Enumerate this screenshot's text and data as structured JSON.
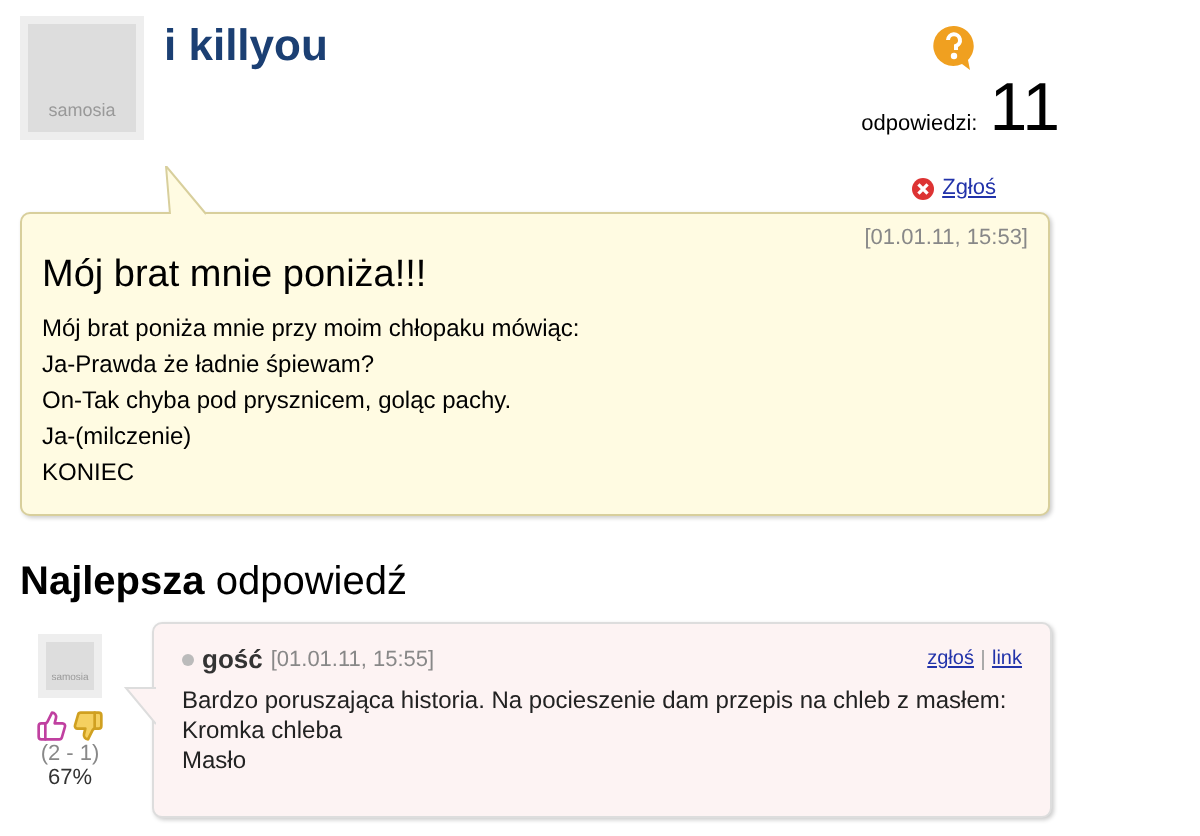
{
  "question": {
    "author": "i killyou",
    "avatar_label": "samosia",
    "answers_label": "odpowiedzi:",
    "answers_count": "11",
    "report": "Zgłoś",
    "date": "[01.01.11, 15:53]",
    "title": "Mój brat mnie poniża!!!",
    "body": [
      "Mój brat poniża mnie przy moim chłopaku mówiąc:",
      "Ja-Prawda że ładnie śpiewam?",
      "On-Tak chyba pod prysznicem, goląc pachy.",
      "Ja-(milczenie)",
      "KONIEC"
    ]
  },
  "best_answer": {
    "heading": "**Najlepsza** odpowiedź",
    "avatar_label": "samosia",
    "votes": "(2 - 1)",
    "percent": "67%",
    "author": "gość",
    "date": "[01.01.11, 15:55]",
    "links": [
      "zgłoś",
      "link"
    ],
    "body": [
      "Bardzo poruszająca historia. Na pocieszenie dam przepis na chleb z masłem:",
      "Kromka chleba",
      "Masło"
    ]
  }
}
